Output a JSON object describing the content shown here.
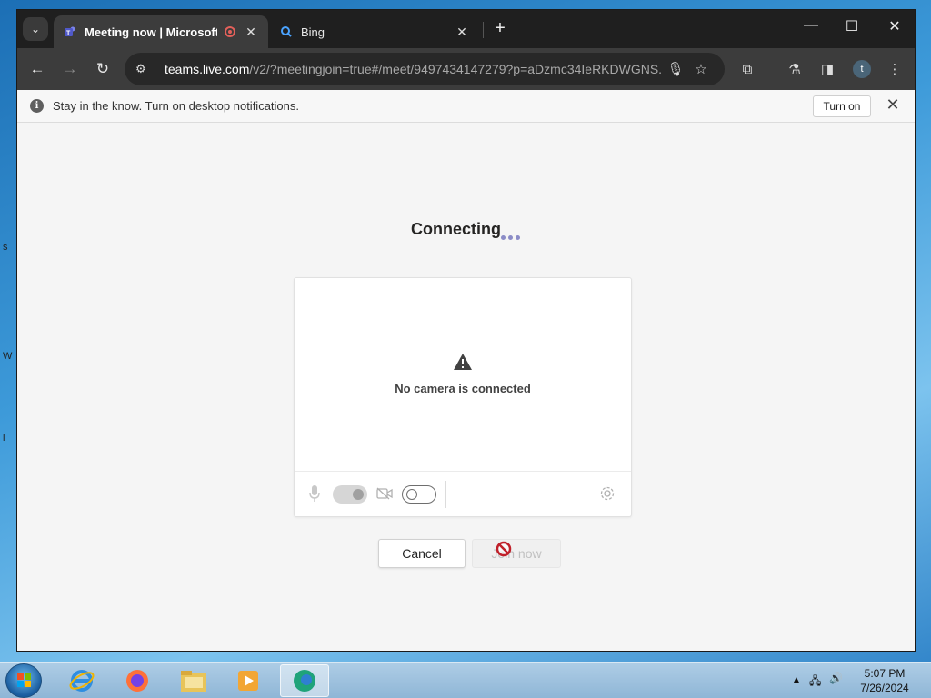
{
  "browser": {
    "tabs": [
      {
        "title": "Meeting now | Microsoft Te",
        "close": "✕"
      },
      {
        "title": "Bing",
        "close": "✕"
      }
    ],
    "new_tab": "+",
    "url_host": "teams.live.com",
    "url_path": "/v2/?meetingjoin=true#/meet/9497434147279?p=aDzmc34IeRKDWGNS...",
    "profile_initial": "t"
  },
  "infobar": {
    "message": "Stay in the know. Turn on desktop notifications.",
    "turn_on_label": "Turn on"
  },
  "meeting": {
    "status": "Connecting",
    "camera_message": "No camera is connected",
    "cancel_label": "Cancel",
    "join_label": "Join now",
    "mic_enabled": true,
    "camera_enabled": false
  },
  "taskbar": {
    "time": "5:07 PM",
    "date": "7/26/2024"
  },
  "colors": {
    "teams_accent": "#8b8cc7",
    "tab_bar": "#1f1f1f",
    "toolbar": "#3c3c3c"
  }
}
